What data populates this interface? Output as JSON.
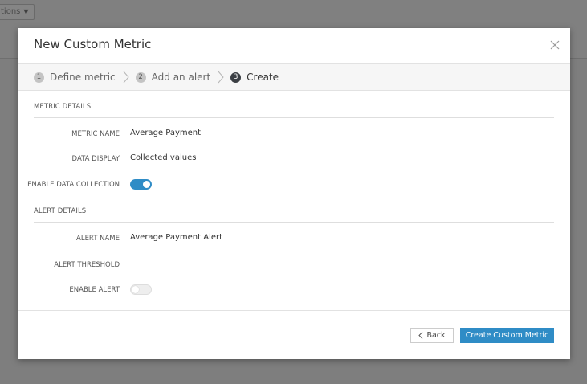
{
  "background": {
    "options_label": "tions"
  },
  "modal": {
    "title": "New Custom Metric",
    "steps": [
      {
        "number": "1",
        "label": "Define metric",
        "active": false
      },
      {
        "number": "2",
        "label": "Add an alert",
        "active": false
      },
      {
        "number": "3",
        "label": "Create",
        "active": true
      }
    ],
    "metric_details": {
      "title": "METRIC DETAILS",
      "metric_name_label": "METRIC NAME",
      "metric_name_value": "Average Payment",
      "data_display_label": "DATA DISPLAY",
      "data_display_value": "Collected values",
      "enable_collection_label": "ENABLE DATA COLLECTION",
      "enable_collection_on": true
    },
    "alert_details": {
      "title": "ALERT DETAILS",
      "alert_name_label": "ALERT NAME",
      "alert_name_value": "Average Payment Alert",
      "alert_threshold_label": "ALERT THRESHOLD",
      "enable_alert_label": "ENABLE ALERT",
      "enable_alert_on": false
    },
    "footer": {
      "back_label": "Back",
      "create_label": "Create Custom Metric"
    }
  },
  "colors": {
    "accent": "#2f8cc6",
    "overlay": "#7e7e7e",
    "active_step": "#3b3f44"
  },
  "icons": {
    "close": "close-icon",
    "step_separator": "chevron-right-icon",
    "back": "chevron-left-icon",
    "dropdown": "caret-down-icon"
  }
}
